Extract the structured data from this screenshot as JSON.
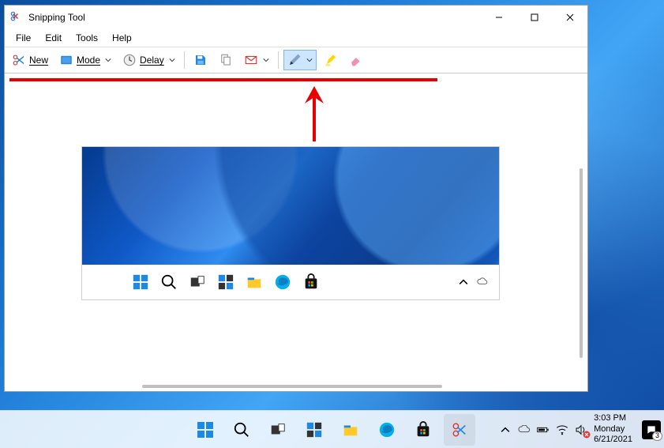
{
  "window": {
    "title": "Snipping Tool"
  },
  "menu": {
    "file": "File",
    "edit": "Edit",
    "tools": "Tools",
    "help": "Help"
  },
  "toolbar": {
    "new": "New",
    "mode": "Mode",
    "delay": "Delay"
  },
  "tray": {
    "time": "3:03 PM",
    "day": "Monday",
    "date": "6/21/2021",
    "notif_count": "3"
  }
}
